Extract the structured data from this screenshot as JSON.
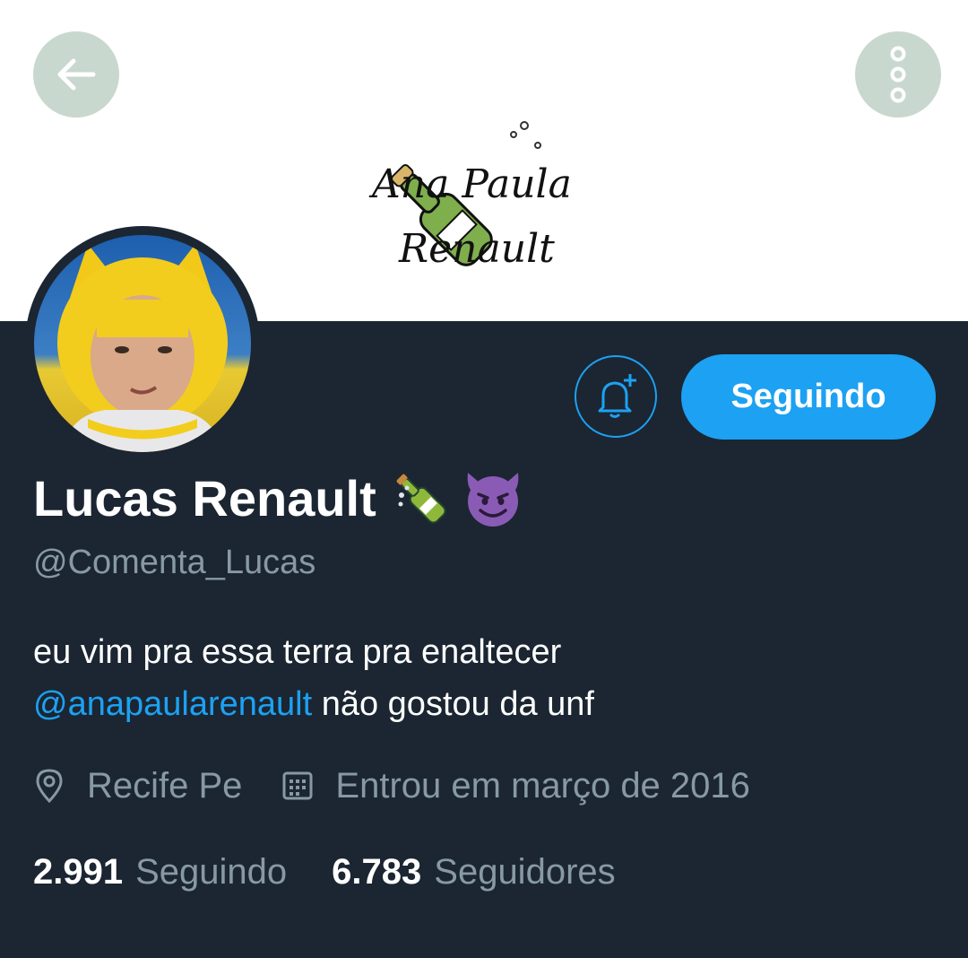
{
  "header": {
    "banner_logo_text": "Ana Paula Renault",
    "back_icon": "arrow-left-icon",
    "more_icon": "more-vertical-icon"
  },
  "profile": {
    "display_name": "Lucas Renault",
    "name_emojis": [
      "champagne-bottle-icon",
      "smiling-devil-icon"
    ],
    "handle": "@Comenta_Lucas",
    "bio_line1": "eu vim pra essa terra pra enaltecer",
    "bio_mention": "@anapaularenault",
    "bio_line2_rest": " não gostou da unf",
    "location": "Recife Pe",
    "joined": "Entrou em março de 2016"
  },
  "actions": {
    "notify_icon": "bell-plus-icon",
    "follow_label": "Seguindo"
  },
  "stats": {
    "following_count": "2.991",
    "following_label": "Seguindo",
    "followers_count": "6.783",
    "followers_label": "Seguidores"
  },
  "colors": {
    "background": "#1b2632",
    "accent": "#1da1f2",
    "secondary_text": "#8899a6",
    "header_button": "#c9d8cf"
  }
}
